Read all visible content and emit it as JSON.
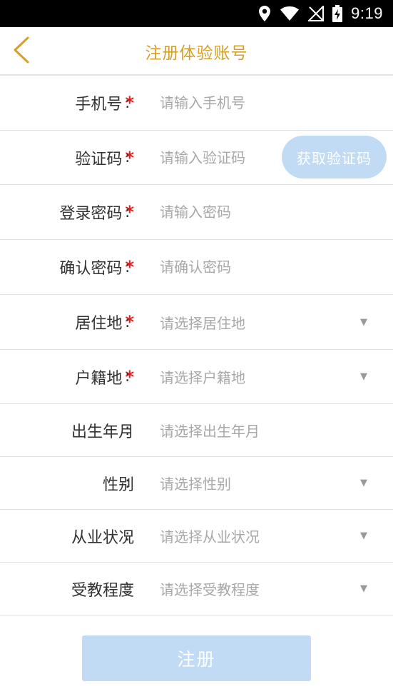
{
  "status_bar": {
    "time": "9:19",
    "icons": [
      "location-icon",
      "wifi-icon",
      "signal-icon",
      "battery-charging-icon"
    ]
  },
  "header": {
    "title": "注册体验账号",
    "back_icon": "chevron-left-icon",
    "accent_color": "#d4a02b"
  },
  "form": {
    "required_mark": "*",
    "colon": ":",
    "fields": [
      {
        "label": "手机号",
        "required": true,
        "placeholder": "请输入手机号",
        "type": "input"
      },
      {
        "label": "验证码",
        "required": true,
        "placeholder": "请输入验证码",
        "type": "input",
        "button": "获取验证码"
      },
      {
        "label": "登录密码",
        "required": true,
        "placeholder": "请输入密码",
        "type": "input"
      },
      {
        "label": "确认密码",
        "required": true,
        "placeholder": "请确认密码",
        "type": "input"
      },
      {
        "label": "居住地",
        "required": true,
        "placeholder": "请选择居住地",
        "type": "select"
      },
      {
        "label": "户籍地",
        "required": true,
        "placeholder": "请选择户籍地",
        "type": "select"
      },
      {
        "label": "出生年月",
        "required": false,
        "placeholder": "请选择出生年月",
        "type": "date"
      },
      {
        "label": "性别",
        "required": false,
        "placeholder": "请选择性别",
        "type": "select"
      },
      {
        "label": "从业状况",
        "required": false,
        "placeholder": "请选择从业状况",
        "type": "select"
      },
      {
        "label": "受教程度",
        "required": false,
        "placeholder": "请选择受教程度",
        "type": "select"
      }
    ]
  },
  "submit": {
    "label": "注册",
    "color": "#c2dbf5"
  }
}
